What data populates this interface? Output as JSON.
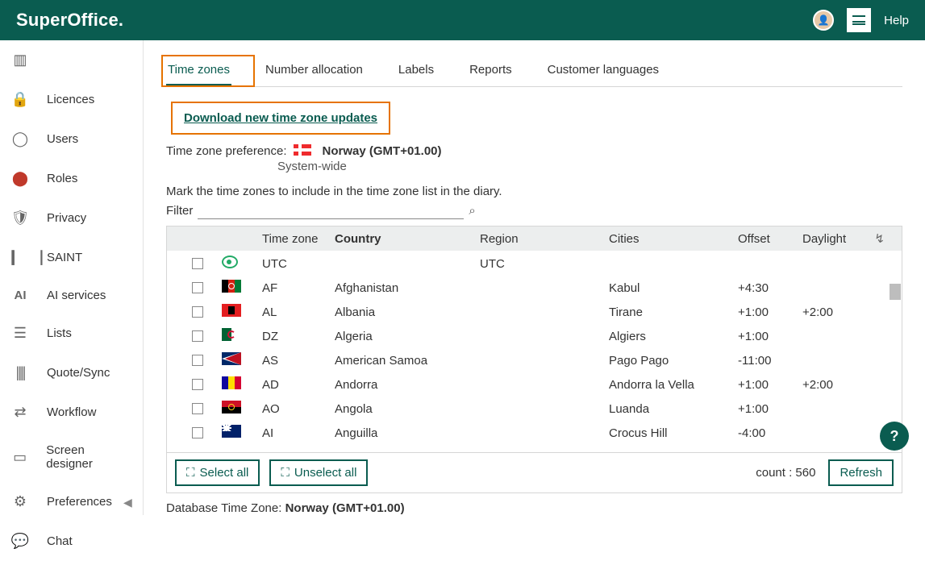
{
  "brand": "SuperOffice.",
  "top": {
    "help": "Help"
  },
  "sidebar": {
    "items": [
      {
        "label": "",
        "icon": "book"
      },
      {
        "label": "Licences",
        "icon": "lock"
      },
      {
        "label": "Users",
        "icon": "user"
      },
      {
        "label": "Roles",
        "icon": "toggle"
      },
      {
        "label": "Privacy",
        "icon": "shield"
      },
      {
        "label": "SAINT",
        "icon": "bars"
      },
      {
        "label": "AI services",
        "icon": "ai"
      },
      {
        "label": "Lists",
        "icon": "list"
      },
      {
        "label": "Quote/Sync",
        "icon": "barcode"
      },
      {
        "label": "Workflow",
        "icon": "workflow"
      },
      {
        "label": "Screen designer",
        "icon": "screen"
      },
      {
        "label": "Preferences",
        "icon": "gear"
      },
      {
        "label": "Chat",
        "icon": "chat"
      }
    ]
  },
  "tabs": [
    "Time zones",
    "Number allocation",
    "Labels",
    "Reports",
    "Customer languages"
  ],
  "download_label": "Download new time zone updates",
  "pref": {
    "label": "Time zone preference:",
    "value": "Norway (GMT+01.00)",
    "scope": "System-wide"
  },
  "instructions": "Mark the time zones to include in the time zone list in the diary.",
  "filter_label": "Filter",
  "columns": {
    "tz": "Time zone",
    "country": "Country",
    "region": "Region",
    "cities": "Cities",
    "offset": "Offset",
    "daylight": "Daylight"
  },
  "rows": [
    {
      "flag": "utc",
      "code": "UTC",
      "country": "",
      "region": "UTC",
      "cities": "",
      "offset": "",
      "daylight": ""
    },
    {
      "flag": "af",
      "code": "AF",
      "country": "Afghanistan",
      "region": "",
      "cities": "Kabul",
      "offset": "+4:30",
      "daylight": ""
    },
    {
      "flag": "al",
      "code": "AL",
      "country": "Albania",
      "region": "",
      "cities": "Tirane",
      "offset": "+1:00",
      "daylight": "+2:00"
    },
    {
      "flag": "dz",
      "code": "DZ",
      "country": "Algeria",
      "region": "",
      "cities": "Algiers",
      "offset": "+1:00",
      "daylight": ""
    },
    {
      "flag": "as",
      "code": "AS",
      "country": "American Samoa",
      "region": "",
      "cities": "Pago Pago",
      "offset": "-11:00",
      "daylight": ""
    },
    {
      "flag": "ad",
      "code": "AD",
      "country": "Andorra",
      "region": "",
      "cities": "Andorra la Vella",
      "offset": "+1:00",
      "daylight": "+2:00"
    },
    {
      "flag": "ao",
      "code": "AO",
      "country": "Angola",
      "region": "",
      "cities": "Luanda",
      "offset": "+1:00",
      "daylight": ""
    },
    {
      "flag": "ai",
      "code": "AI",
      "country": "Anguilla",
      "region": "",
      "cities": "Crocus Hill",
      "offset": "-4:00",
      "daylight": ""
    }
  ],
  "buttons": {
    "select_all": "Select all",
    "unselect_all": "Unselect all",
    "refresh": "Refresh"
  },
  "count_label": "count : 560",
  "db_tz": {
    "label": "Database Time Zone:",
    "value": "Norway (GMT+01.00)"
  },
  "fab": "?"
}
